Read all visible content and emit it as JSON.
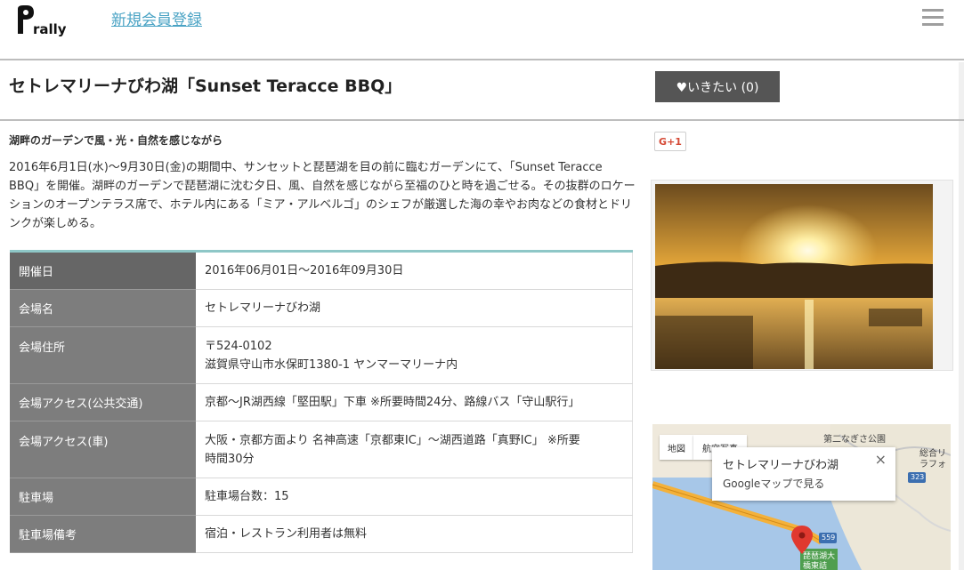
{
  "header": {
    "logo_text": "rally",
    "signup_label": "新規会員登録"
  },
  "event": {
    "title": "セトレマリーナびわ湖「Sunset Teracce BBQ」",
    "like_label": "♥いきたい (0)",
    "subheading": "湖畔のガーデンで風・光・自然を感じながら",
    "description": "2016年6月1日(水)～9月30日(金)の期間中、サンセットと琵琶湖を目の前に臨むガーデンにて、「Sunset Teracce BBQ」を開催。湖畔のガーデンで琵琶湖に沈む夕日、風、自然を感じながら至福のひと時を過ごせる。その抜群のロケーションのオープンテラス席で、ホテル内にある「ミア・アルベルゴ」のシェフが厳選した海の幸やお肉などの食材とドリンクが楽しめる。"
  },
  "details": [
    {
      "label": "開催日",
      "value": "2016年06月01日～2016年09月30日"
    },
    {
      "label": "会場名",
      "value": "セトレマリーナびわ湖"
    },
    {
      "label": "会場住所",
      "value": "〒524-0102",
      "value2": "滋賀県守山市水保町1380-1 ヤンマーマリーナ内"
    },
    {
      "label": "会場アクセス(公共交通)",
      "value": "京都～JR湖西線「堅田駅」下車 ※所要時間24分、路線バス「守山駅行」"
    },
    {
      "label": "会場アクセス(車)",
      "value": "大阪・京都方面より 名神高速「京都東IC」～湖西道路「真野IC」 ※所要",
      "value2": "時間30分"
    },
    {
      "label": "駐車場",
      "value": "駐車場台数：15"
    },
    {
      "label": "駐車場備考",
      "value": "宿泊・レストラン利用者は無料"
    }
  ],
  "social": {
    "gplus_label": "G+1"
  },
  "map": {
    "tab_map": "地図",
    "tab_satellite": "航空写真",
    "popup_title": "セトレマリーナびわ湖",
    "popup_link": "Googleマップで見る",
    "popup_close": "×",
    "label_park": "第二なぎさ公園",
    "label_general": "総合リ",
    "label_general2": "ラフォ",
    "label_road_323": "323",
    "label_road_559": "559",
    "label_bridge": "琵琶湖大",
    "label_bridge2": "橋東詰"
  },
  "colors": {
    "signup_link": "#4aa3c4",
    "like_button": "#555555",
    "table_header": "#7d7d7d",
    "table_accent": "#8ec7c7",
    "gplus": "#d54935"
  }
}
